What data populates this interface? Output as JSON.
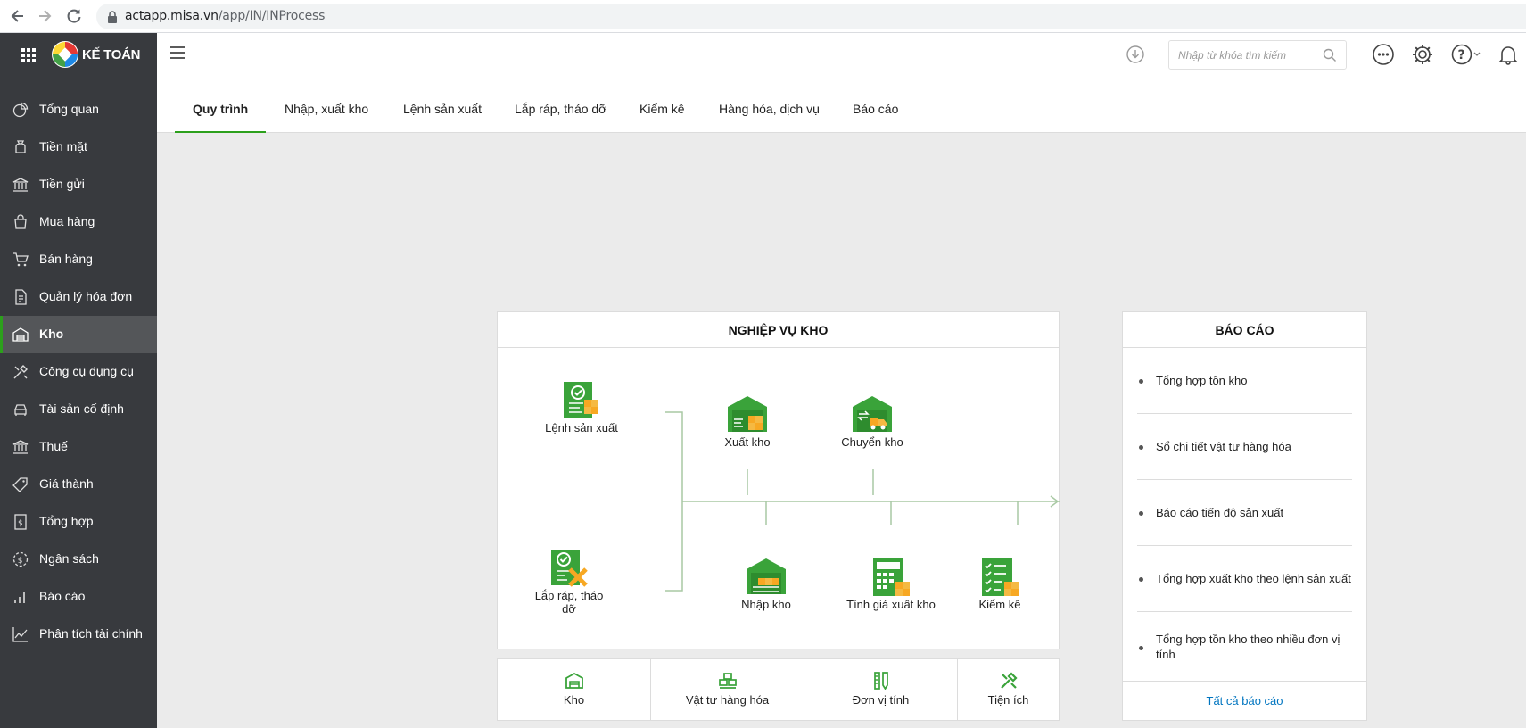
{
  "browser": {
    "url_host": "actapp.misa.vn",
    "url_path": "/app/IN/INProcess"
  },
  "brand": {
    "name": "KẾ TOÁN"
  },
  "sidebar": {
    "items": [
      {
        "label": "Tổng quan",
        "icon": "dashboard-icon"
      },
      {
        "label": "Tiền mặt",
        "icon": "cash-bag-icon"
      },
      {
        "label": "Tiền gửi",
        "icon": "bank-icon"
      },
      {
        "label": "Mua hàng",
        "icon": "shopping-bag-icon"
      },
      {
        "label": "Bán hàng",
        "icon": "cart-icon"
      },
      {
        "label": "Quản lý hóa đơn",
        "icon": "invoice-icon"
      },
      {
        "label": "Kho",
        "icon": "warehouse-icon"
      },
      {
        "label": "Công cụ dụng cụ",
        "icon": "tools-icon"
      },
      {
        "label": "Tài sản cố định",
        "icon": "car-icon"
      },
      {
        "label": "Thuế",
        "icon": "tax-icon"
      },
      {
        "label": "Giá thành",
        "icon": "price-tag-icon"
      },
      {
        "label": "Tổng hợp",
        "icon": "summary-icon"
      },
      {
        "label": "Ngân sách",
        "icon": "budget-icon"
      },
      {
        "label": "Báo cáo",
        "icon": "report-icon"
      },
      {
        "label": "Phân tích tài chính",
        "icon": "analytics-icon"
      }
    ],
    "active_index": 6
  },
  "header": {
    "search_placeholder": "Nhập từ khóa tìm kiếm"
  },
  "tabs": [
    {
      "label": "Quy trình",
      "active": true
    },
    {
      "label": "Nhập, xuất kho",
      "active": false
    },
    {
      "label": "Lệnh sản xuất",
      "active": false
    },
    {
      "label": "Lắp ráp, tháo dỡ",
      "active": false
    },
    {
      "label": "Kiểm kê",
      "active": false
    },
    {
      "label": "Hàng hóa, dịch vụ",
      "active": false
    },
    {
      "label": "Báo cáo",
      "active": false
    }
  ],
  "process_panel": {
    "title": "NGHIỆP VỤ KHO",
    "nodes": {
      "production_order": "Lệnh sản xuất",
      "assembly_line1": "Lắp ráp, tháo",
      "assembly_line2": "dỡ",
      "stock_out": "Xuất kho",
      "transfer": "Chuyển kho",
      "stock_in": "Nhập kho",
      "cost_calc": "Tính giá xuất kho",
      "inventory_check": "Kiểm kê"
    }
  },
  "report_panel": {
    "title": "BÁO CÁO",
    "items": [
      "Tổng hợp tồn kho",
      "Sổ chi tiết vật tư hàng hóa",
      "Báo cáo tiến độ sản xuất",
      "Tổng hợp xuất kho theo lệnh sản xuất",
      "Tổng hợp tồn kho theo nhiều đơn vị tính"
    ],
    "all_link": "Tất cả báo cáo"
  },
  "shortcuts": [
    {
      "label": "Kho",
      "icon": "warehouse-icon"
    },
    {
      "label": "Vật tư hàng hóa",
      "icon": "goods-icon"
    },
    {
      "label": "Đơn vị tính",
      "icon": "unit-icon"
    },
    {
      "label": "Tiện ích",
      "icon": "utility-icon"
    }
  ],
  "colors": {
    "accent": "#2ca01c",
    "sidebar_bg": "#383a3e",
    "link": "#0075c0",
    "icon_green": "#3aa33a",
    "icon_orange": "#f7a823"
  }
}
